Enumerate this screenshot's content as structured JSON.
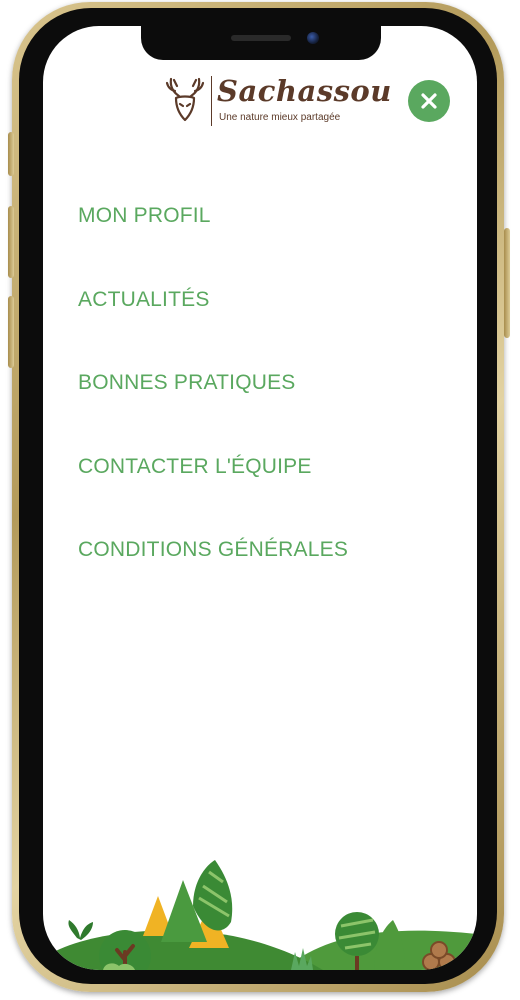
{
  "header": {
    "brand_name": "Sachassou",
    "tagline": "Une nature mieux partagée",
    "logo_icon": "deer-antlers-icon",
    "close_icon": "close-icon"
  },
  "menu": {
    "items": [
      {
        "label": "MON PROFIL"
      },
      {
        "label": "ACTUALITÉS"
      },
      {
        "label": "BONNES PRATIQUES"
      },
      {
        "label": "CONTACTER L'ÉQUIPE"
      },
      {
        "label": "CONDITIONS GÉNÉRALES"
      }
    ]
  },
  "colors": {
    "accent": "#5aa85f",
    "brand_brown": "#5b3a29",
    "background": "#ffffff"
  }
}
